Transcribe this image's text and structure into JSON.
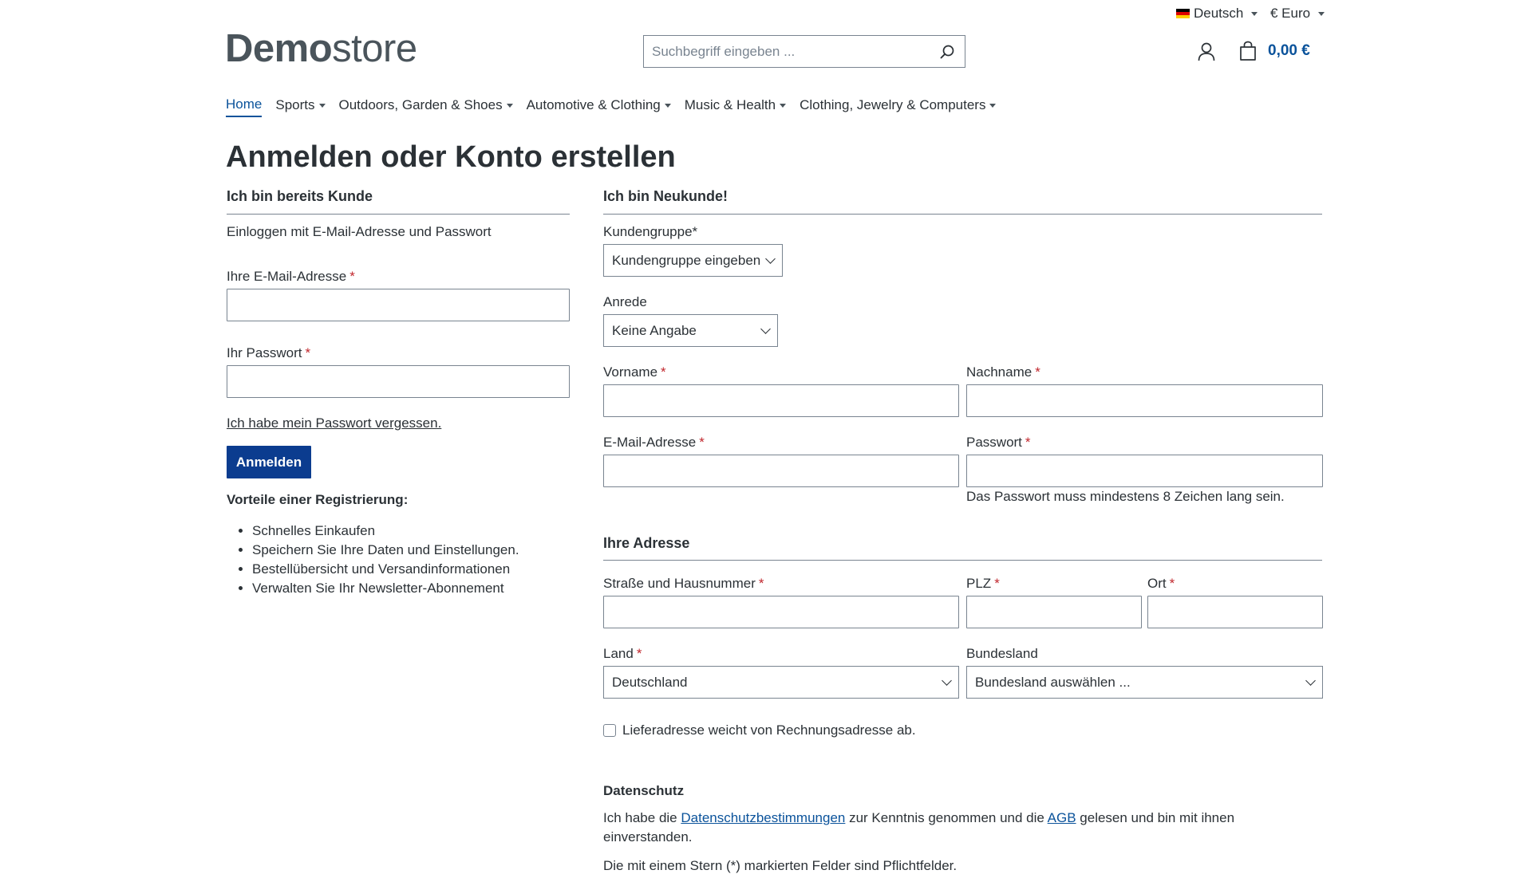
{
  "topbar": {
    "language": "Deutsch",
    "currency": "€ Euro"
  },
  "header": {
    "logo_bold": "Demo",
    "logo_light": "store",
    "search_placeholder": "Suchbegriff eingeben ...",
    "cart_total": "0,00 €"
  },
  "nav": {
    "items": [
      {
        "label": "Home",
        "active": true,
        "has_caret": false
      },
      {
        "label": "Sports",
        "has_caret": true
      },
      {
        "label": "Outdoors, Garden & Shoes",
        "has_caret": true
      },
      {
        "label": "Automotive & Clothing",
        "has_caret": true
      },
      {
        "label": "Music & Health",
        "has_caret": true
      },
      {
        "label": "Clothing, Jewelry & Computers",
        "has_caret": true
      }
    ]
  },
  "page": {
    "title": "Anmelden oder Konto erstellen"
  },
  "login": {
    "heading": "Ich bin bereits Kunde",
    "subtitle": "Einloggen mit E-Mail-Adresse und Passwort",
    "email_label": "Ihre E-Mail-Adresse",
    "password_label": "Ihr Passwort",
    "forgot_link": "Ich habe mein Passwort vergessen.",
    "submit": "Anmelden",
    "benefits_heading": "Vorteile einer Registrierung:",
    "benefits": [
      "Schnelles Einkaufen",
      "Speichern Sie Ihre Daten und Einstellungen.",
      "Bestellübersicht und Versandinformationen",
      "Verwalten Sie Ihr Newsletter-Abonnement"
    ]
  },
  "register": {
    "heading": "Ich bin Neukunde!",
    "customer_group_label": "Kundengruppe*",
    "customer_group_value": "Kundengruppe eingeben",
    "salutation_label": "Anrede",
    "salutation_value": "Keine Angabe",
    "firstname_label": "Vorname",
    "lastname_label": "Nachname",
    "email_label": "E-Mail-Adresse",
    "password_label": "Passwort",
    "password_hint": "Das Passwort muss mindestens 8 Zeichen lang sein.",
    "address_heading": "Ihre Adresse",
    "street_label": "Straße und Hausnummer",
    "zip_label": "PLZ",
    "city_label": "Ort",
    "country_label": "Land",
    "country_value": "Deutschland",
    "state_label": "Bundesland",
    "state_value": "Bundesland auswählen ...",
    "different_shipping_label": "Lieferadresse weicht von Rechnungsadresse ab.",
    "privacy_heading": "Datenschutz",
    "privacy_text_1": "Ich habe die ",
    "privacy_link": "Datenschutzbestimmungen",
    "privacy_text_2": " zur Kenntnis genommen und die ",
    "agb_link": "AGB",
    "privacy_text_3": " gelesen und bin mit ihnen einverstanden.",
    "required_note": "Die mit einem Stern (*) markierten Felder sind Pflichtfelder."
  },
  "colors": {
    "primary": "#0b539b",
    "button": "#0b3c8f",
    "required": "#c1272d"
  }
}
